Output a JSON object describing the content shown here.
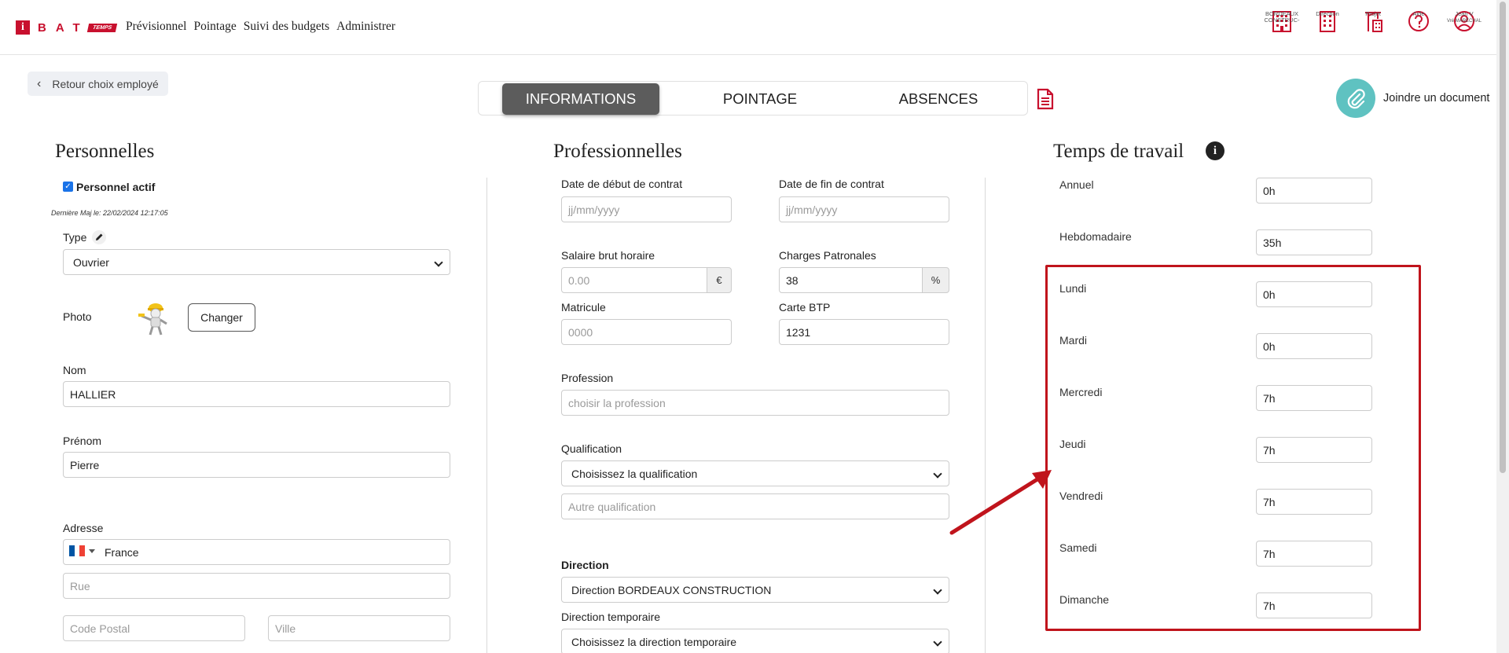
{
  "header": {
    "logo_i": "i",
    "logo_bat": "BAT",
    "logo_temps": "TEMPS",
    "nav": [
      "Prévisionnel",
      "Pointage",
      "Suivi des budgets",
      "Administrer"
    ],
    "icons": [
      {
        "name": "company-icon",
        "label": "BORDEAUX CONSTRUC-"
      },
      {
        "name": "direction-icon",
        "label": "Direction"
      },
      {
        "name": "project-icon",
        "label": "Projet"
      },
      {
        "name": "help-icon",
        "label": "Aide"
      },
      {
        "name": "user-icon",
        "label": "Jean V",
        "sub": "Vré MARÉCHAL"
      }
    ]
  },
  "back_button": "Retour choix employé",
  "tabs": [
    "INFORMATIONS",
    "POINTAGE",
    "ABSENCES"
  ],
  "active_tab": "INFORMATIONS",
  "join_document": "Joindre un document",
  "personnelles": {
    "title": "Personnelles",
    "active_label": "Personnel actif",
    "last_update": "Dernière Maj le: 22/02/2024 12:17:05",
    "type_label": "Type",
    "type_value": "Ouvrier",
    "photo_label": "Photo",
    "change_button": "Changer",
    "nom_label": "Nom",
    "nom_value": "HALLIER",
    "prenom_label": "Prénom",
    "prenom_value": "Pierre",
    "adresse_label": "Adresse",
    "country": "France",
    "rue_placeholder": "Rue",
    "cp_placeholder": "Code Postal",
    "ville_placeholder": "Ville"
  },
  "professionnelles": {
    "title": "Professionnelles",
    "date_debut_label": "Date de début de contrat",
    "date_debut_placeholder": "jj/mm/yyyy",
    "date_fin_label": "Date de fin de contrat",
    "date_fin_placeholder": "jj/mm/yyyy",
    "salaire_label": "Salaire brut horaire",
    "salaire_placeholder": "0.00",
    "salaire_unit": "€",
    "charges_label": "Charges Patronales",
    "charges_value": "38",
    "charges_unit": "%",
    "matricule_label": "Matricule",
    "matricule_placeholder": "0000",
    "carte_btp_label": "Carte BTP",
    "carte_btp_value": "1231",
    "profession_label": "Profession",
    "profession_placeholder": "choisir la profession",
    "qualification_label": "Qualification",
    "qualification_value": "Choisissez la qualification",
    "autre_qualification_placeholder": "Autre qualification",
    "direction_label": "Direction",
    "direction_value": "Direction BORDEAUX CONSTRUCTION",
    "direction_temp_label": "Direction temporaire",
    "direction_temp_value": "Choisissez la direction temporaire"
  },
  "temps_travail": {
    "title": "Temps de travail",
    "rows": [
      {
        "label": "Annuel",
        "value": "0h"
      },
      {
        "label": "Hebdomadaire",
        "value": "35h"
      },
      {
        "label": "Lundi",
        "value": "0h"
      },
      {
        "label": "Mardi",
        "value": "0h"
      },
      {
        "label": "Mercredi",
        "value": "7h"
      },
      {
        "label": "Jeudi",
        "value": "7h"
      },
      {
        "label": "Vendredi",
        "value": "7h"
      },
      {
        "label": "Samedi",
        "value": "7h"
      },
      {
        "label": "Dimanche",
        "value": "7h"
      }
    ]
  },
  "colors": {
    "brand": "#c8102e",
    "highlight_box": "#c0141c",
    "active_tab": "#5c5c5c",
    "attach_button": "#5fc2c1"
  }
}
